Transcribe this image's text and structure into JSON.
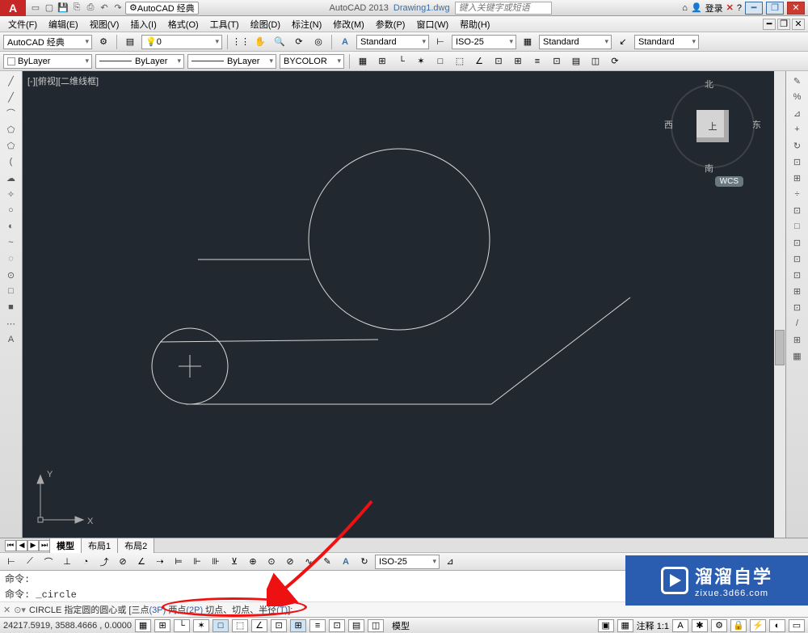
{
  "title_bar": {
    "app_name": "AutoCAD 2013",
    "doc_name": "Drawing1.dwg",
    "workspace": "AutoCAD 经典",
    "search_placeholder": "键入关键字或短语",
    "login_label": "登录"
  },
  "menus": [
    "文件(F)",
    "编辑(E)",
    "视图(V)",
    "插入(I)",
    "格式(O)",
    "工具(T)",
    "绘图(D)",
    "标注(N)",
    "修改(M)",
    "参数(P)",
    "窗口(W)",
    "帮助(H)"
  ],
  "row1": {
    "workspace": "AutoCAD 经典",
    "layer_combo": "0",
    "style": "Standard",
    "dimstyle": "ISO-25",
    "table_style": "Standard",
    "mleader_style": "Standard"
  },
  "row2": {
    "layer_filter": "ByLayer",
    "lt1": "ByLayer",
    "lt2": "ByLayer",
    "color": "BYCOLOR"
  },
  "viewport": {
    "label": "[-][俯视][二维线框]",
    "cube": {
      "top": "上",
      "n": "北",
      "s": "南",
      "e": "东",
      "w": "西"
    },
    "wcs": "WCS",
    "axis_x": "X",
    "axis_y": "Y"
  },
  "tabs": {
    "model": "模型",
    "layout1": "布局1",
    "layout2": "布局2"
  },
  "lower": {
    "dimstyle": "ISO-25"
  },
  "command": {
    "line1": "命令:",
    "line2": "命令: _circle",
    "prefix": "CIRCLE 指定圆的圆心或 [三点",
    "p3p": "(3P)",
    "mid1": " 两点",
    "p2p": "(2P)",
    "mid2": " 切点、切点、半径",
    "pt": "(T)",
    "suffix": "]:"
  },
  "status": {
    "coords": "24217.5919, 3588.4666 , 0.0000",
    "scale": "注释 1:1",
    "model_btn": "模型"
  },
  "watermark": {
    "big": "溜溜自学",
    "small": "zixue.3d66.com"
  },
  "left_tools": [
    "╱",
    "╱",
    "⌒",
    "⬠",
    "⬠",
    "(",
    "☁",
    "✧",
    "○",
    "◐",
    "~",
    "◌",
    "⊙",
    "□",
    "■",
    "⋯",
    "A"
  ],
  "right_tools": [
    "✎",
    "%",
    "⊿",
    "+",
    "↻",
    "⊡",
    "⊞",
    "÷",
    "⊡",
    "□",
    "⊡",
    "⊡",
    "⊡",
    "⊞",
    "⊡",
    "/",
    "⊞",
    "▦"
  ]
}
